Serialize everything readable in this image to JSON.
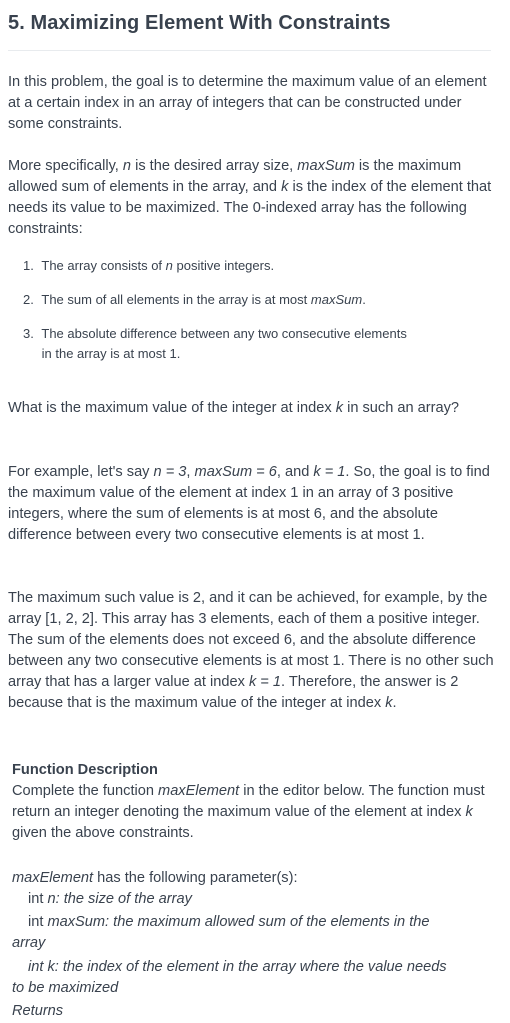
{
  "title": "5. Maximizing Element With Constraints",
  "intro": "In this problem, the goal is to determine the maximum value of an element at a certain index in an array of integers that can be constructed under some constraints.",
  "spec": {
    "t1": "More specifically, ",
    "n": "n",
    "t2": " is the desired array size, ",
    "maxSum": "maxSum",
    "t3": " is the maximum allowed sum of elements in the array, and ",
    "k": "k",
    "t4": " is the index of the element that needs its value to be maximized. The 0-indexed array has the following constraints:"
  },
  "constraints": [
    {
      "num": "1.",
      "a": "The array consists of ",
      "v": "n",
      "b": " positive integers."
    },
    {
      "num": "2.",
      "a": "The sum of all elements in the array is at most ",
      "v": "maxSum",
      "b": "."
    },
    {
      "num": "3.",
      "a": "The absolute difference between any two consecutive elements",
      "line2": "in the array is at most 1."
    }
  ],
  "question": {
    "a": "What is the maximum value of the integer at index ",
    "k": "k",
    "b": " in such an array?"
  },
  "example": {
    "a": "For example, let's say ",
    "n": "n = 3",
    "c1": ", ",
    "ms": "maxSum = 6",
    "c2": ", and ",
    "k": "k = 1",
    "b": ". So, the goal is to find the maximum value of the element at index 1 in an array of 3 positive integers, where the sum of elements is at most 6, and the absolute difference between every two consecutive elements is at most 1."
  },
  "answer": {
    "a": "The maximum such value is 2, and it can be achieved, for example, by the array [1, 2, 2]. This array has 3 elements, each of them a positive integer. The sum of the elements does not exceed 6, and the absolute difference between any two consecutive elements is at most 1. There is no other such array that has a larger value at index ",
    "k1": "k = 1",
    "b": ". Therefore, the answer is 2 because that is the maximum value of the integer at index ",
    "k2": "k",
    "c": "."
  },
  "function_description": {
    "heading": "Function Description",
    "a": "Complete the function ",
    "fn": "maxElement",
    "b": " in the editor below. The function must return an integer denoting the maximum value of the element at index ",
    "k": "k",
    "c": " given the above constraints."
  },
  "params": {
    "fn": "maxElement",
    "rest": " has the following parameter(s):",
    "p1_type": "int ",
    "p1_name": "n",
    "p1_desc": ": the size of the array",
    "p2_type": "int ",
    "p2_name": "maxSum",
    "p2_desc": ": the maximum allowed sum of the elements in the",
    "p2_line2": "array",
    "p3_line1": "int k: the index of the element in the array where the value needs",
    "p3_line2": "to be maximized"
  },
  "returns_label": "Returns"
}
